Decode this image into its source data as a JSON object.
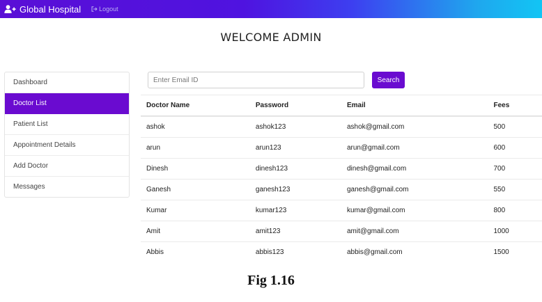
{
  "navbar": {
    "brand_icon": "user-plus-icon",
    "brand": "Global Hospital",
    "logout_icon": "sign-out-icon",
    "logout": "Logout",
    "gradient_colors": [
      "#5a0fd6",
      "#4f13e0",
      "#3d3ff0",
      "#1fa7ee",
      "#12c5f4"
    ]
  },
  "header": {
    "title": "WELCOME ADMIN"
  },
  "sidebar": {
    "items": [
      {
        "label": "Dashboard"
      },
      {
        "label": "Doctor List"
      },
      {
        "label": "Patient List"
      },
      {
        "label": "Appointment Details"
      },
      {
        "label": "Add Doctor"
      },
      {
        "label": "Messages"
      }
    ],
    "active_label": "Doctor List",
    "accent_color": "#6a0bd0"
  },
  "search": {
    "placeholder": "Enter Email ID",
    "value": "",
    "button_label": "Search"
  },
  "table": {
    "columns": [
      "Doctor Name",
      "Password",
      "Email",
      "Fees"
    ],
    "rows": [
      [
        "ashok",
        "ashok123",
        "ashok@gmail.com",
        "500"
      ],
      [
        "arun",
        "arun123",
        "arun@gmail.com",
        "600"
      ],
      [
        "Dinesh",
        "dinesh123",
        "dinesh@gmail.com",
        "700"
      ],
      [
        "Ganesh",
        "ganesh123",
        "ganesh@gmail.com",
        "550"
      ],
      [
        "Kumar",
        "kumar123",
        "kumar@gmail.com",
        "800"
      ],
      [
        "Amit",
        "amit123",
        "amit@gmail.com",
        "1000"
      ],
      [
        "Abbis",
        "abbis123",
        "abbis@gmail.com",
        "1500"
      ]
    ]
  },
  "caption": "Fig 1.16"
}
